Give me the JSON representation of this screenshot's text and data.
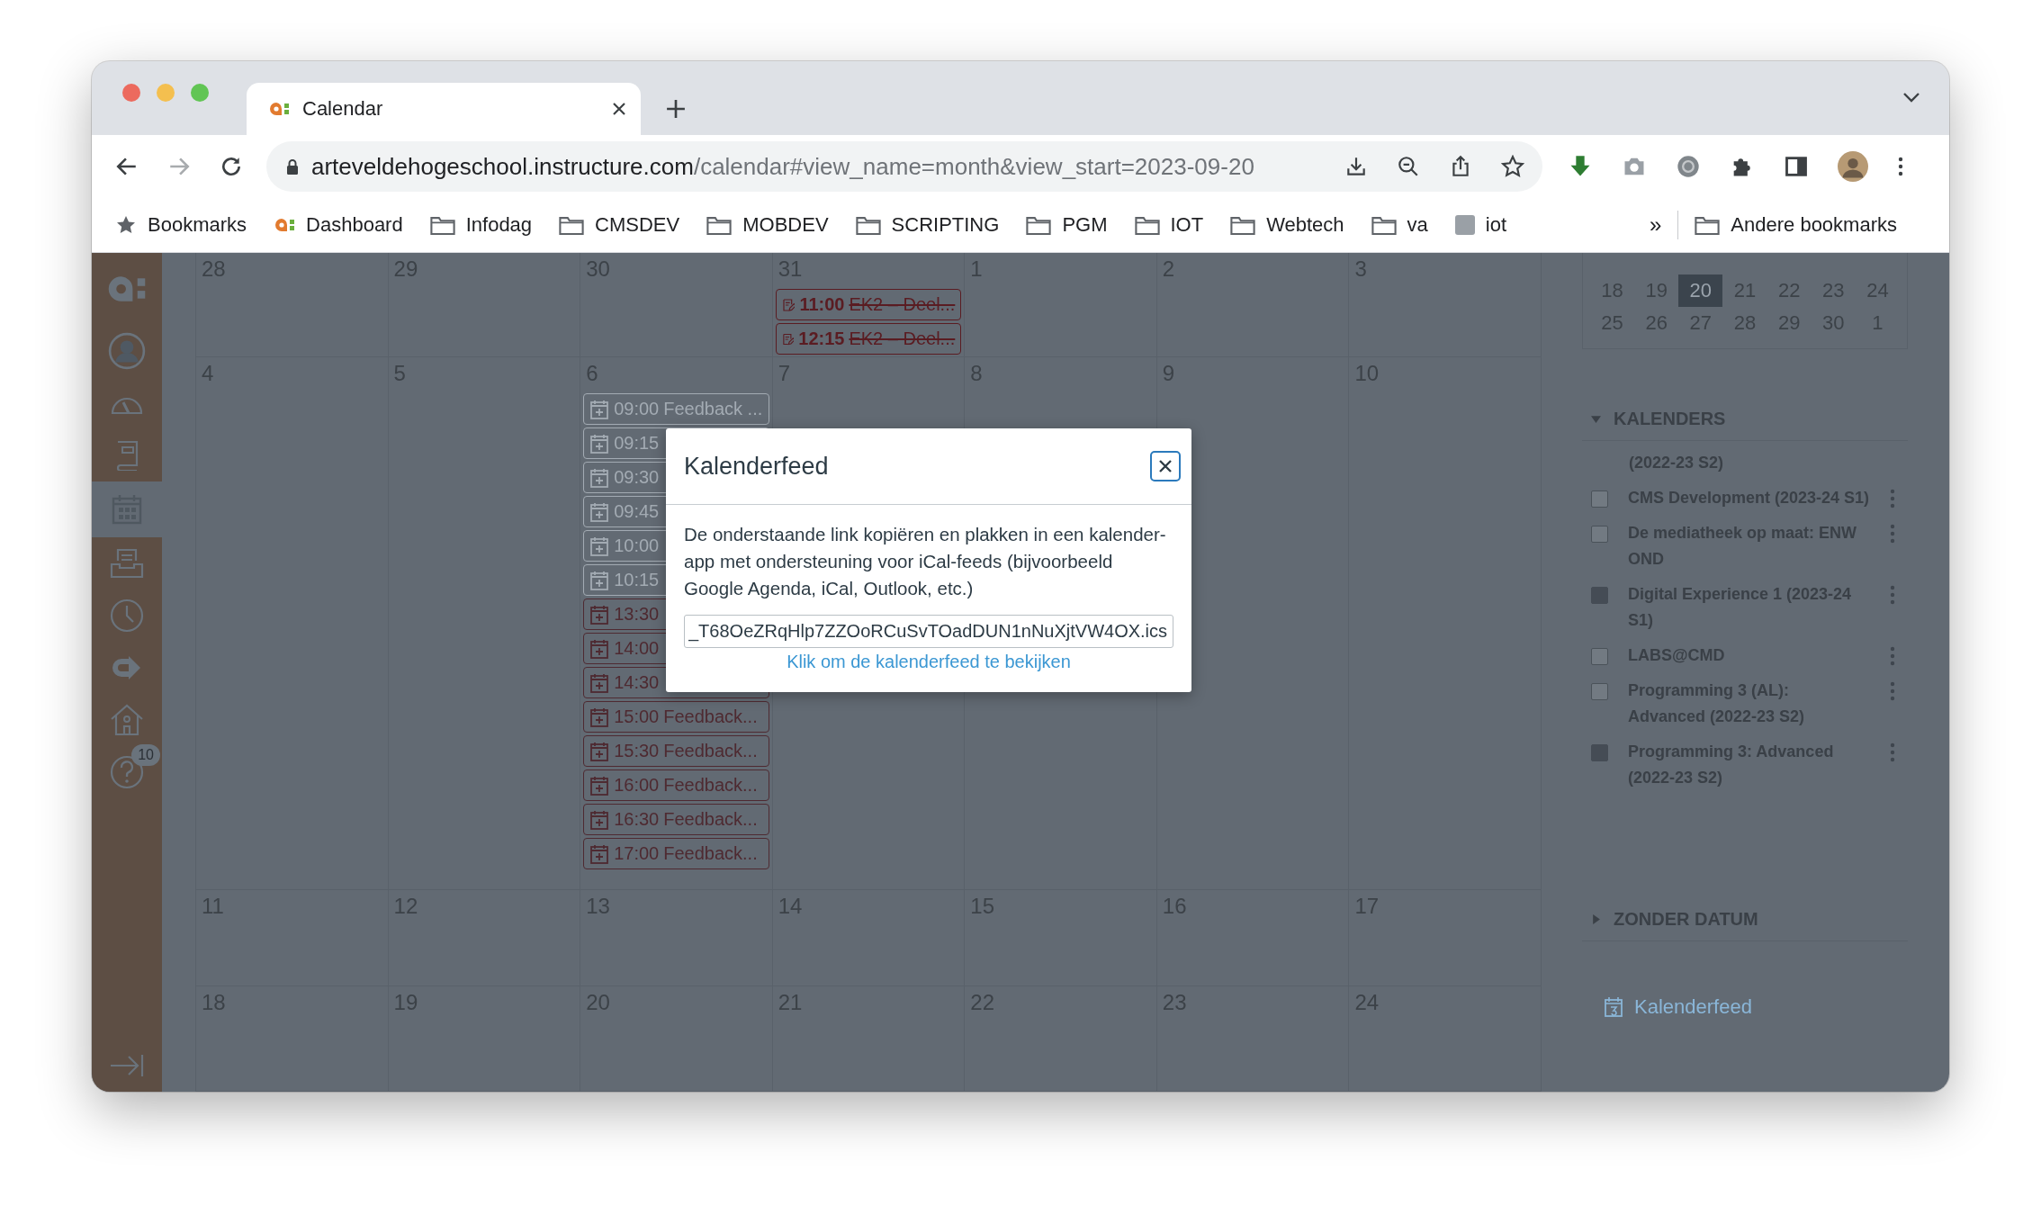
{
  "browser": {
    "tabs": [
      {
        "title": "Calendar",
        "selected": true
      }
    ],
    "address": {
      "host": "arteveldehogeschool.instructure.com",
      "path": "/calendar#view_name=month&view_start=2023-09-20"
    },
    "bookmarks": [
      {
        "label": "Bookmarks",
        "kind": "star"
      },
      {
        "label": "Dashboard",
        "kind": "site"
      },
      {
        "label": "Infodag",
        "kind": "folder"
      },
      {
        "label": "CMSDEV",
        "kind": "folder"
      },
      {
        "label": "MOBDEV",
        "kind": "folder"
      },
      {
        "label": "SCRIPTING",
        "kind": "folder"
      },
      {
        "label": "PGM",
        "kind": "folder"
      },
      {
        "label": "IOT",
        "kind": "folder"
      },
      {
        "label": "Webtech",
        "kind": "folder"
      },
      {
        "label": "va",
        "kind": "folder"
      },
      {
        "label": "iot",
        "kind": "page"
      }
    ],
    "overflow": "»",
    "other_bookmarks": "Andere bookmarks"
  },
  "nav": {
    "items": [
      {
        "kind": "logo",
        "selected": false
      },
      {
        "kind": "account",
        "selected": false
      },
      {
        "kind": "dashboard",
        "selected": false
      },
      {
        "kind": "courses",
        "selected": false
      },
      {
        "kind": "calendar",
        "selected": true
      },
      {
        "kind": "inbox",
        "selected": false
      },
      {
        "kind": "history",
        "selected": false
      },
      {
        "kind": "commons",
        "selected": false
      },
      {
        "kind": "home",
        "selected": false
      },
      {
        "kind": "help",
        "selected": false,
        "badge": "10"
      }
    ]
  },
  "calendar": {
    "weeks": [
      {
        "days": [
          {
            "number": "28"
          },
          {
            "number": "29"
          },
          {
            "number": "30"
          },
          {
            "number": "31",
            "events": [
              {
                "kind": "assignment",
                "time": "11:00",
                "title": "EK2 – Deel...",
                "struck": true,
                "color": "#5a1c22"
              },
              {
                "kind": "assignment",
                "time": "12:15",
                "title": "EK2 – Deel...",
                "struck": true,
                "color": "#5a1c22"
              }
            ]
          },
          {
            "number": "1"
          },
          {
            "number": "2"
          },
          {
            "number": "3"
          }
        ]
      },
      {
        "days": [
          {
            "number": "4"
          },
          {
            "number": "5"
          },
          {
            "number": "6",
            "events": [
              {
                "kind": "appointment",
                "time": "09:00",
                "title": "Feedback ...",
                "struck": false,
                "color": "#a3abb3"
              },
              {
                "kind": "appointment",
                "time": "09:15",
                "color": "#a3abb3"
              },
              {
                "kind": "appointment",
                "time": "09:30",
                "color": "#a3abb3"
              },
              {
                "kind": "appointment",
                "time": "09:45",
                "color": "#a3abb3"
              },
              {
                "kind": "appointment",
                "time": "10:00",
                "color": "#a3abb3"
              },
              {
                "kind": "appointment",
                "time": "10:15",
                "color": "#a3abb3"
              },
              {
                "kind": "appointment",
                "time": "13:30",
                "color": "#4e2a31"
              },
              {
                "kind": "appointment",
                "time": "14:00",
                "color": "#4e2a31"
              },
              {
                "kind": "appointment",
                "time": "14:30",
                "color": "#4e2a31"
              },
              {
                "kind": "appointment",
                "time": "15:00",
                "title": "Feedback...",
                "struck": false,
                "color": "#4e2a31"
              },
              {
                "kind": "appointment",
                "time": "15:30",
                "title": "Feedback...",
                "struck": false,
                "color": "#4e2a31"
              },
              {
                "kind": "appointment",
                "time": "16:00",
                "title": "Feedback...",
                "struck": false,
                "color": "#4e2a31"
              },
              {
                "kind": "appointment",
                "time": "16:30",
                "title": "Feedback...",
                "struck": false,
                "color": "#4e2a31"
              },
              {
                "kind": "appointment",
                "time": "17:00",
                "title": "Feedback...",
                "struck": false,
                "color": "#4e2a31"
              }
            ]
          },
          {
            "number": "7"
          },
          {
            "number": "8"
          },
          {
            "number": "9"
          },
          {
            "number": "10"
          }
        ]
      },
      {
        "days": [
          {
            "number": "11"
          },
          {
            "number": "12"
          },
          {
            "number": "13"
          },
          {
            "number": "14"
          },
          {
            "number": "15"
          },
          {
            "number": "16"
          },
          {
            "number": "17"
          }
        ]
      },
      {
        "days": [
          {
            "number": "18"
          },
          {
            "number": "19"
          },
          {
            "number": "20"
          },
          {
            "number": "21"
          },
          {
            "number": "22"
          },
          {
            "number": "23"
          },
          {
            "number": "24"
          }
        ]
      }
    ]
  },
  "sidebar": {
    "mini_calendar": {
      "weeks": [
        [
          {
            "day": "18",
            "selected": false
          },
          {
            "day": "19",
            "selected": false
          },
          {
            "day": "20",
            "selected": true
          },
          {
            "day": "21",
            "selected": false
          },
          {
            "day": "22",
            "selected": false
          },
          {
            "day": "23",
            "selected": false
          },
          {
            "day": "24",
            "selected": false
          }
        ],
        [
          {
            "day": "25",
            "selected": false
          },
          {
            "day": "26",
            "selected": false
          },
          {
            "day": "27",
            "selected": false
          },
          {
            "day": "28",
            "selected": false
          },
          {
            "day": "29",
            "selected": false
          },
          {
            "day": "30",
            "selected": false
          },
          {
            "day": "1",
            "selected": false
          }
        ]
      ]
    },
    "calendars_heading": "KALENDERS",
    "calendars_expanded": true,
    "calendars_partial": "(2022-23 S2)",
    "calendars": [
      {
        "name": "CMS Development (2023-24 S1)",
        "checked": false
      },
      {
        "name": "De mediatheek op maat: ENW OND",
        "checked": false
      },
      {
        "name": "Digital Experience 1 (2023-24 S1)",
        "checked": true
      },
      {
        "name": "LABS@CMD",
        "checked": false
      },
      {
        "name": "Programming 3 (AL): Advanced (2022-23 S2)",
        "checked": false
      },
      {
        "name": "Programming 3: Advanced (2022-23 S2)",
        "checked": true
      }
    ],
    "undated_heading": "ZONDER DATUM",
    "undated_expanded": false,
    "feed_link": "Kalenderfeed"
  },
  "modal": {
    "title": "Kalenderfeed",
    "text": "De onderstaande link kopiëren en plakken in een kalender-app met ondersteuning voor iCal-feeds (bijvoorbeeld Google Agenda, iCal, Outlook, etc.)",
    "feed_url": "_T68OeZRqHlp7ZZOoRCuSvTOadDUN1nNuXjtVW4OX.ics",
    "link": "Klik om de kalenderfeed te bekijken"
  }
}
